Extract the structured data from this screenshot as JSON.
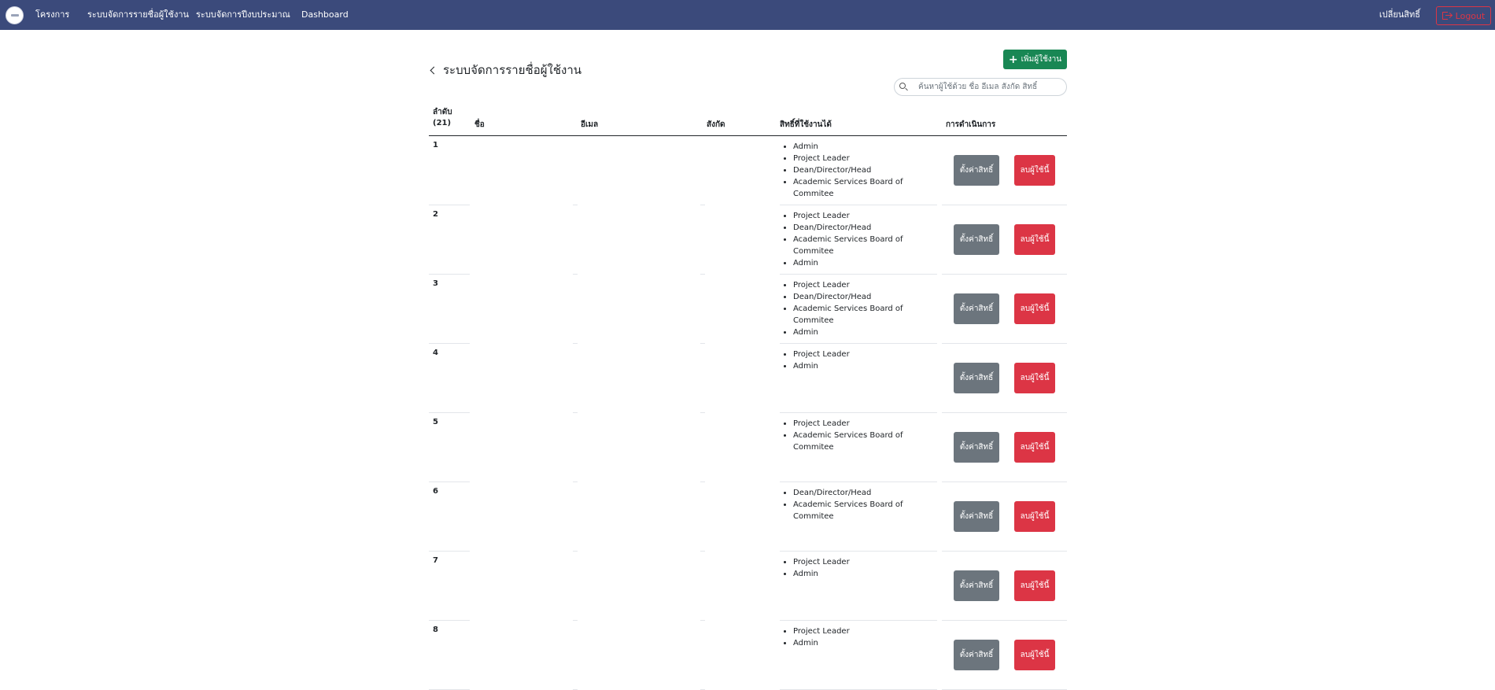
{
  "navbar": {
    "logo_alt": "logo",
    "links": [
      "โครงการ",
      "ระบบจัดการรายชื่อผู้ใช้งาน",
      "ระบบจัดการปีงบประมาณ",
      "Dashboard"
    ],
    "switch_role": "เปลี่ยนสิทธิ์",
    "logout": "Logout"
  },
  "page": {
    "title": "ระบบจัดการรายชื่อผู้ใช้งาน",
    "add_user_label": "เพิ่มผู้ใช้งาน",
    "search_placeholder": "ค้นหาผู้ใช้ด้วย ชื่อ อีเมล สังกัด สิทธิ์"
  },
  "table": {
    "headers": {
      "order": "ลำดับ",
      "count": "(21)",
      "name": "ชื่อ",
      "email": "อีเมล",
      "affiliation": "สังกัด",
      "rights": "สิทธิ์ที่ใช้งานได้",
      "actions": "การดำเนินการ"
    },
    "rows": [
      {
        "num": "1",
        "rights": [
          "Admin",
          "Project Leader",
          "Dean/Director/Head",
          "Academic Services Board of Commitee"
        ]
      },
      {
        "num": "2",
        "rights": [
          "Project Leader",
          "Dean/Director/Head",
          "Academic Services Board of Commitee",
          "Admin"
        ]
      },
      {
        "num": "3",
        "rights": [
          "Project Leader",
          "Dean/Director/Head",
          "Academic Services Board of Commitee",
          "Admin"
        ]
      },
      {
        "num": "4",
        "rights": [
          "Project Leader",
          "Admin"
        ]
      },
      {
        "num": "5",
        "rights": [
          "Project Leader",
          "Academic Services Board of Commitee"
        ]
      },
      {
        "num": "6",
        "rights": [
          "Dean/Director/Head",
          "Academic Services Board of Commitee"
        ]
      },
      {
        "num": "7",
        "rights": [
          "Project Leader",
          "Admin"
        ]
      },
      {
        "num": "8",
        "rights": [
          "Project Leader",
          "Admin"
        ]
      }
    ],
    "set_rights_label": "ตั้งค่าสิทธิ์",
    "delete_label": "ลบผู้ใช้นี้"
  },
  "colors": {
    "navbar": "#3b4a7b",
    "add_button": "#198754",
    "rights_button": "#6c757d",
    "delete_button": "#dc3545"
  }
}
